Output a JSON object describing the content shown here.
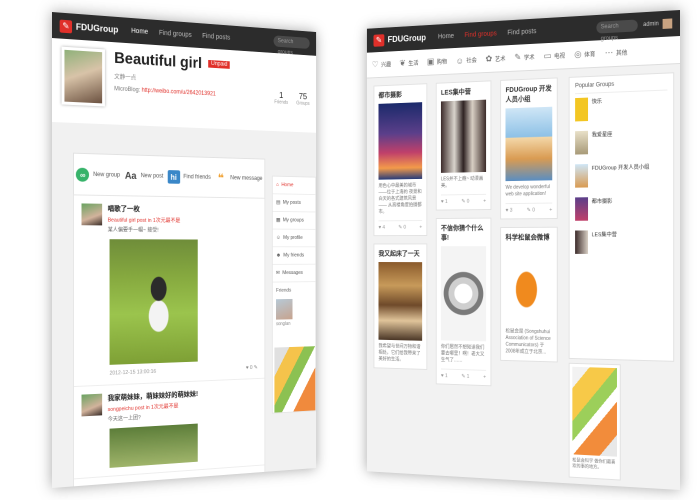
{
  "left_window": {
    "logo": "FDUGroup",
    "nav": [
      "Home",
      "Find groups",
      "Find posts"
    ],
    "search_placeholder": "Search groups",
    "profile": {
      "name": "Beautiful girl",
      "badge": "Unpaid",
      "motto": "文静一点",
      "blog_label": "MicroBlog:",
      "blog_url": "http://weibo.com/u/2642013921",
      "stats": [
        {
          "num": "1",
          "label": "Friends"
        },
        {
          "num": "75",
          "label": "Groups"
        }
      ]
    },
    "actions": [
      {
        "label": "New group",
        "icon": "link-icon",
        "color": "#37b36a",
        "glyph": "∞"
      },
      {
        "label": "New post",
        "icon": "font-icon",
        "color": "#444444",
        "glyph": "Aa"
      },
      {
        "label": "Find friends",
        "icon": "hi-icon",
        "color": "#3a87c8",
        "glyph": "hi"
      },
      {
        "label": "New message",
        "icon": "quote-icon",
        "color": "#f0a030",
        "glyph": "❝"
      }
    ],
    "posts": [
      {
        "title": "唱歌了一枚",
        "meta": "Beautiful girl post in 1次元最不是",
        "text": "某人偏要手一帽~ 接受!",
        "time": "2012-12-15 13:00:16",
        "likes": "0"
      },
      {
        "title": "我家萌妹妹，萌妹妹好的萌妹妹!",
        "meta": "songpeichu post in 1次元最不是",
        "text": "今天这一上团?"
      }
    ],
    "side_menu": [
      "Home",
      "My posts",
      "My groups",
      "My profile",
      "My friends",
      "Messages"
    ],
    "friends_label": "Friends",
    "friend_name": "songlan"
  },
  "right_window": {
    "logo": "FDUGroup",
    "nav": [
      "Home",
      "Find groups",
      "Find posts"
    ],
    "search_placeholder": "Search groups",
    "user": "admin",
    "categories": [
      "兴趣",
      "生活",
      "购物",
      "社会",
      "艺术",
      "学术",
      "电视",
      "体育",
      "其他"
    ],
    "cards": [
      {
        "title": "都市摄影",
        "text": "用色心中最美的城市 ——位于上海的 夜景和白天的各式建筑风景 —— 从高楼角度拍摄都市。",
        "likes": "4",
        "comments": "0"
      },
      {
        "title": "我又起床了一天",
        "text": "我希望与世间万物和谐相处，它们给我带来了美好的生活。"
      },
      {
        "title": "LES集中营",
        "text": "LES并不上瘾~ 动漫画美。",
        "likes": "1",
        "comments": "0"
      },
      {
        "title": "不信你猜个什么事!",
        "text": "你们居然不想知道我们要去哪里！啊！老大又生气了……",
        "likes": "1",
        "comments": "1"
      },
      {
        "title": "FDUGroup 开发人员小组",
        "text": "We develop wonderful web site application!",
        "likes": "3",
        "comments": "0"
      },
      {
        "title": "科学松鼠会微博",
        "text": "松鼠会是 (Songshuhui Association of Science Communicators) 于2008年成立于北京..."
      }
    ],
    "popular_head": "Popular Groups",
    "popular": [
      "快乐",
      "我爱星座",
      "FDUGroup 开发人员小组",
      "都市摄影",
      "LES集中营"
    ],
    "books_text": "松鼠会科学 做你们最喜欢的事的地方。"
  }
}
